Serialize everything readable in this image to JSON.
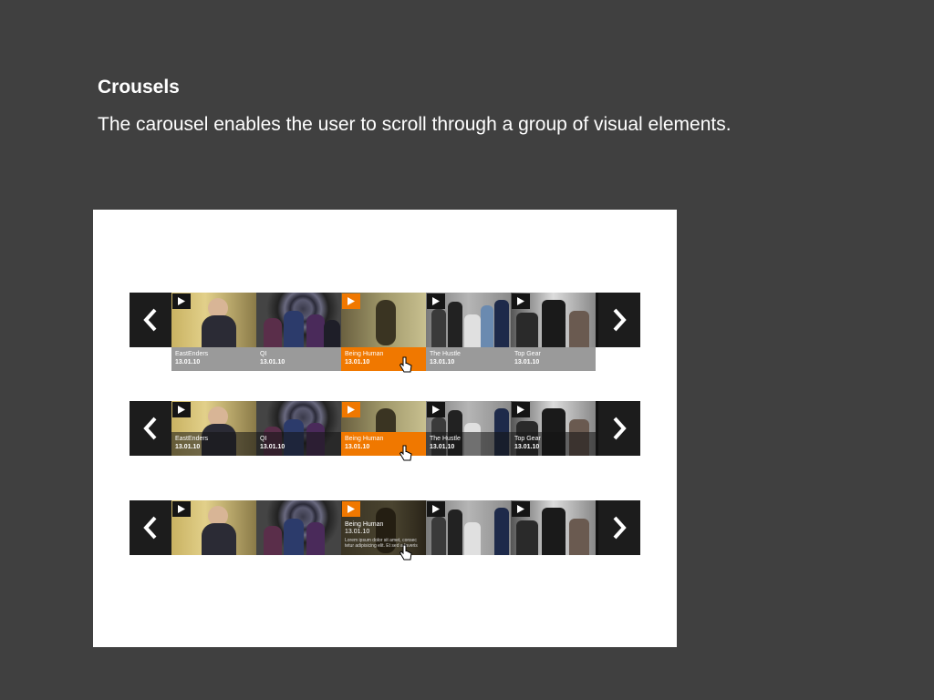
{
  "slide": {
    "title": "Crousels",
    "description": "The carousel enables the user to scroll through a group of visual elements."
  },
  "colors": {
    "background": "#404040",
    "panel": "#ffffff",
    "active_caption": "#f07800",
    "inactive_caption": "#9a9a9a"
  },
  "icons": {
    "prev": "chevron-left-icon",
    "next": "chevron-right-icon",
    "play": "play-icon",
    "cursor": "hand-pointer-icon"
  },
  "carousels": [
    {
      "state": "captions-below",
      "items": [
        {
          "title": "EastEnders",
          "date": "13.01.10"
        },
        {
          "title": "QI",
          "date": "13.01.10"
        },
        {
          "title": "Being Human",
          "date": "13.01.10"
        },
        {
          "title": "The Hustle",
          "date": "13.01.10"
        },
        {
          "title": "Top Gear",
          "date": "13.01.10"
        }
      ]
    },
    {
      "state": "captions-overlay",
      "items": [
        {
          "title": "EastEnders",
          "date": "13.01.10"
        },
        {
          "title": "QI",
          "date": "13.01.10"
        },
        {
          "title": "Being Human",
          "date": "13.01.10"
        },
        {
          "title": "The Hustle",
          "date": "13.01.10"
        },
        {
          "title": "Top Gear",
          "date": "13.01.10"
        }
      ]
    },
    {
      "state": "expanded-description",
      "expanded": {
        "title": "Being Human",
        "date": "13.01.10",
        "summary": "Lorem ipsum dolor sit amet, consec tetur adipisicing elit. Et sed a faveris"
      }
    }
  ]
}
